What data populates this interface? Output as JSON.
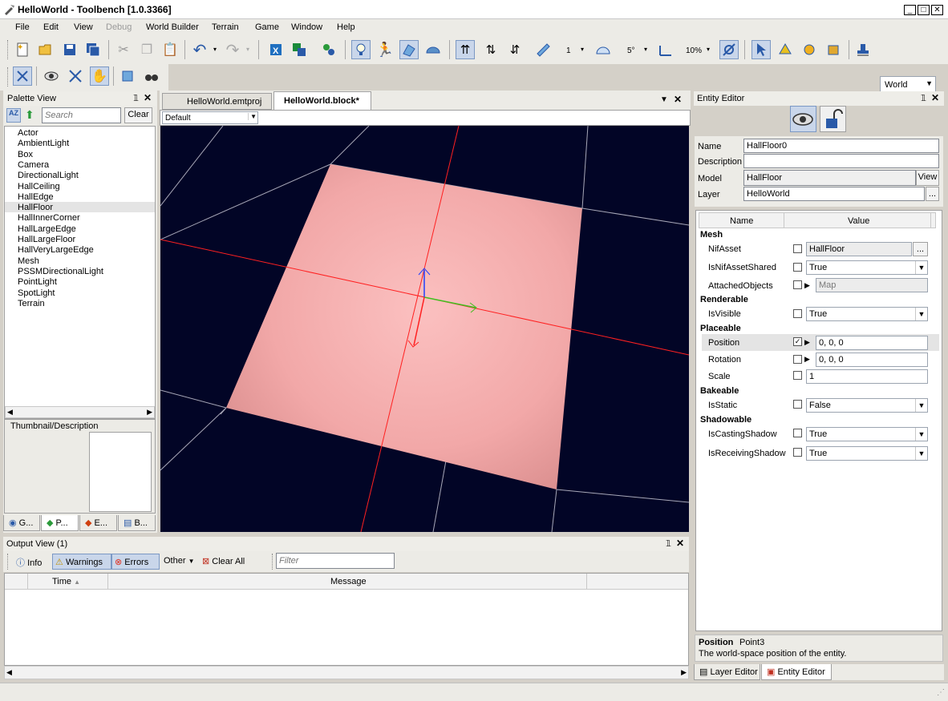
{
  "window": {
    "title": "HelloWorld - Toolbench [1.0.3366]",
    "min": "_",
    "max": "□",
    "close": "✕"
  },
  "menu": [
    "File",
    "Edit",
    "View",
    "Debug",
    "World Builder",
    "Terrain",
    "Game",
    "Window",
    "Help"
  ],
  "toolbar": {
    "snap_value": "1",
    "angle_value": "5°",
    "percent_value": "10%",
    "space": "World"
  },
  "palette": {
    "title": "Palette View",
    "search_placeholder": "Search",
    "clear_label": "Clear",
    "items": [
      "Actor",
      "AmbientLight",
      "Box",
      "Camera",
      "DirectionalLight",
      "HallCeiling",
      "HallEdge",
      "HallFloor",
      "HallInnerCorner",
      "HallLargeEdge",
      "HallLargeFloor",
      "HallVeryLargeEdge",
      "Mesh",
      "PSSMDirectionalLight",
      "PointLight",
      "SpotLight",
      "Terrain"
    ],
    "selected": "HallFloor",
    "thumbnail_label": "Thumbnail/Description",
    "tabs": [
      "G...",
      "P...",
      "E...",
      "B..."
    ]
  },
  "documents": {
    "tabs": [
      "HelloWorld.emtproj",
      "HelloWorld.block*"
    ],
    "active": "HelloWorld.block*",
    "view_mode": "Default"
  },
  "output": {
    "title": "Output View (1)",
    "info_label": "Info",
    "warnings_label": "Warnings",
    "errors_label": "Errors",
    "other_label": "Other",
    "clear_all_label": "Clear All",
    "filter_placeholder": "Filter",
    "columns": [
      "Time",
      "Message"
    ]
  },
  "entity_editor": {
    "title": "Entity Editor",
    "name_label": "Name",
    "name_value": "HallFloor0",
    "description_label": "Description",
    "description_value": "",
    "model_label": "Model",
    "model_value": "HallFloor",
    "view_label": "View",
    "layer_label": "Layer",
    "layer_value": "HelloWorld",
    "ellipsis": "...",
    "grid_columns": [
      "Name",
      "Value"
    ],
    "categories": {
      "mesh": "Mesh",
      "renderable": "Renderable",
      "placeable": "Placeable",
      "bakeable": "Bakeable",
      "shadowable": "Shadowable"
    },
    "props": {
      "nif_asset": {
        "name": "NifAsset",
        "value": "HallFloor"
      },
      "is_nif_asset_shared": {
        "name": "IsNifAssetShared",
        "value": "True"
      },
      "attached_objects": {
        "name": "AttachedObjects",
        "value": "Map"
      },
      "is_visible": {
        "name": "IsVisible",
        "value": "True"
      },
      "position": {
        "name": "Position",
        "value": "0, 0, 0"
      },
      "rotation": {
        "name": "Rotation",
        "value": "0, 0, 0"
      },
      "scale": {
        "name": "Scale",
        "value": "1"
      },
      "is_static": {
        "name": "IsStatic",
        "value": "False"
      },
      "is_casting_shadow": {
        "name": "IsCastingShadow",
        "value": "True"
      },
      "is_receiving_shadow": {
        "name": "IsReceivingShadow",
        "value": "True"
      }
    },
    "help_title": "Position",
    "help_type": "Point3",
    "help_text": "The world-space position of the entity.",
    "bottom_tabs": [
      "Layer Editor",
      "Entity Editor"
    ]
  },
  "colors": {
    "viewport_bg": "#020526",
    "floor": "#f4a8a8",
    "selection": "#c9d6ea"
  }
}
